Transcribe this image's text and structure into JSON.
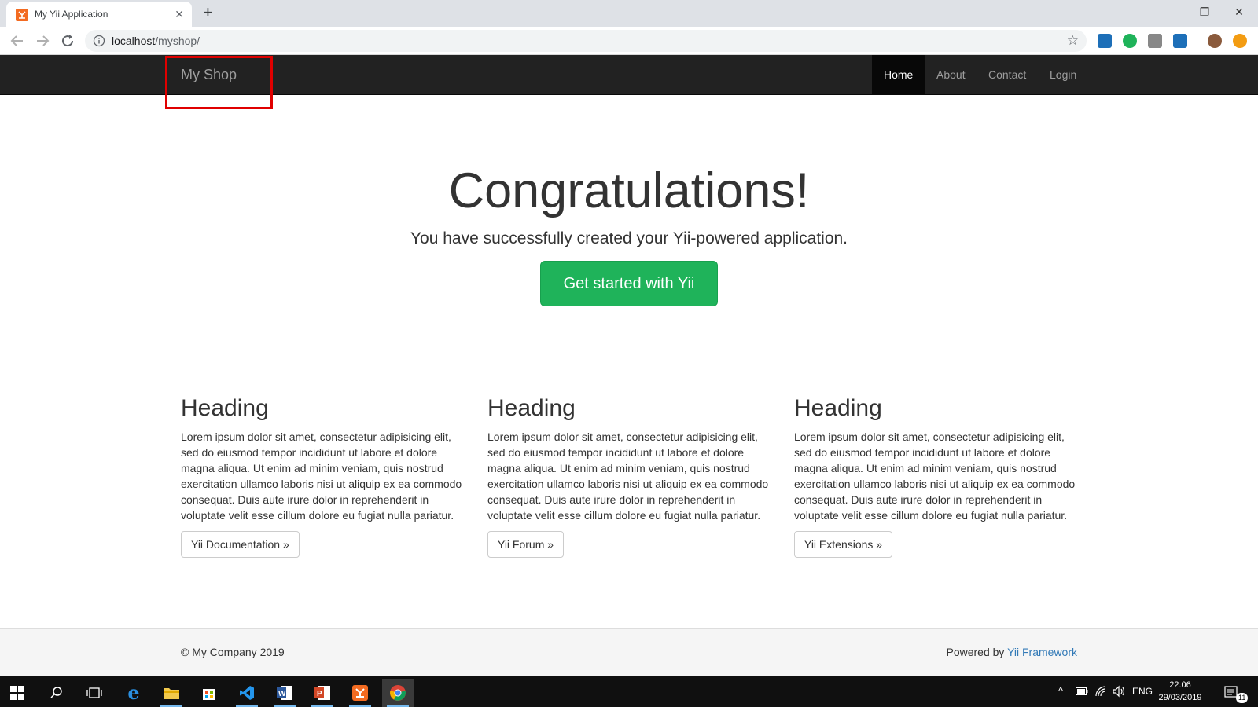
{
  "browser": {
    "tab_title": "My Yii Application",
    "tab_close": "✕",
    "new_tab": "+",
    "url_host": "localhost",
    "url_path": "/myshop/",
    "window_controls": [
      "—",
      "❐",
      "✕"
    ]
  },
  "navbar": {
    "brand": "My Shop",
    "items": [
      {
        "label": "Home",
        "active": true
      },
      {
        "label": "About",
        "active": false
      },
      {
        "label": "Contact",
        "active": false
      },
      {
        "label": "Login",
        "active": false
      }
    ]
  },
  "jumbotron": {
    "title": "Congratulations!",
    "lead": "You have successfully created your Yii-powered application.",
    "button": "Get started with Yii"
  },
  "columns": [
    {
      "heading": "Heading",
      "body": "Lorem ipsum dolor sit amet, consectetur adipisicing elit, sed do eiusmod tempor incididunt ut labore et dolore magna aliqua. Ut enim ad minim veniam, quis nostrud exercitation ullamco laboris nisi ut aliquip ex ea commodo consequat. Duis aute irure dolor in reprehenderit in voluptate velit esse cillum dolore eu fugiat nulla pariatur.",
      "button": "Yii Documentation »"
    },
    {
      "heading": "Heading",
      "body": "Lorem ipsum dolor sit amet, consectetur adipisicing elit, sed do eiusmod tempor incididunt ut labore et dolore magna aliqua. Ut enim ad minim veniam, quis nostrud exercitation ullamco laboris nisi ut aliquip ex ea commodo consequat. Duis aute irure dolor in reprehenderit in voluptate velit esse cillum dolore eu fugiat nulla pariatur.",
      "button": "Yii Forum »"
    },
    {
      "heading": "Heading",
      "body": "Lorem ipsum dolor sit amet, consectetur adipisicing elit, sed do eiusmod tempor incididunt ut labore et dolore magna aliqua. Ut enim ad minim veniam, quis nostrud exercitation ullamco laboris nisi ut aliquip ex ea commodo consequat. Duis aute irure dolor in reprehenderit in voluptate velit esse cillum dolore eu fugiat nulla pariatur.",
      "button": "Yii Extensions »"
    }
  ],
  "footer": {
    "copyright": "© My Company 2019",
    "powered_prefix": "Powered by ",
    "powered_link": "Yii Framework"
  },
  "taskbar": {
    "language": "ENG",
    "time": "22.06",
    "date": "29/03/2019",
    "notification_count": "11"
  },
  "colors": {
    "navbar_bg": "#222222",
    "success": "#1fb35a",
    "link": "#337ab7",
    "highlight": "#e00000"
  }
}
